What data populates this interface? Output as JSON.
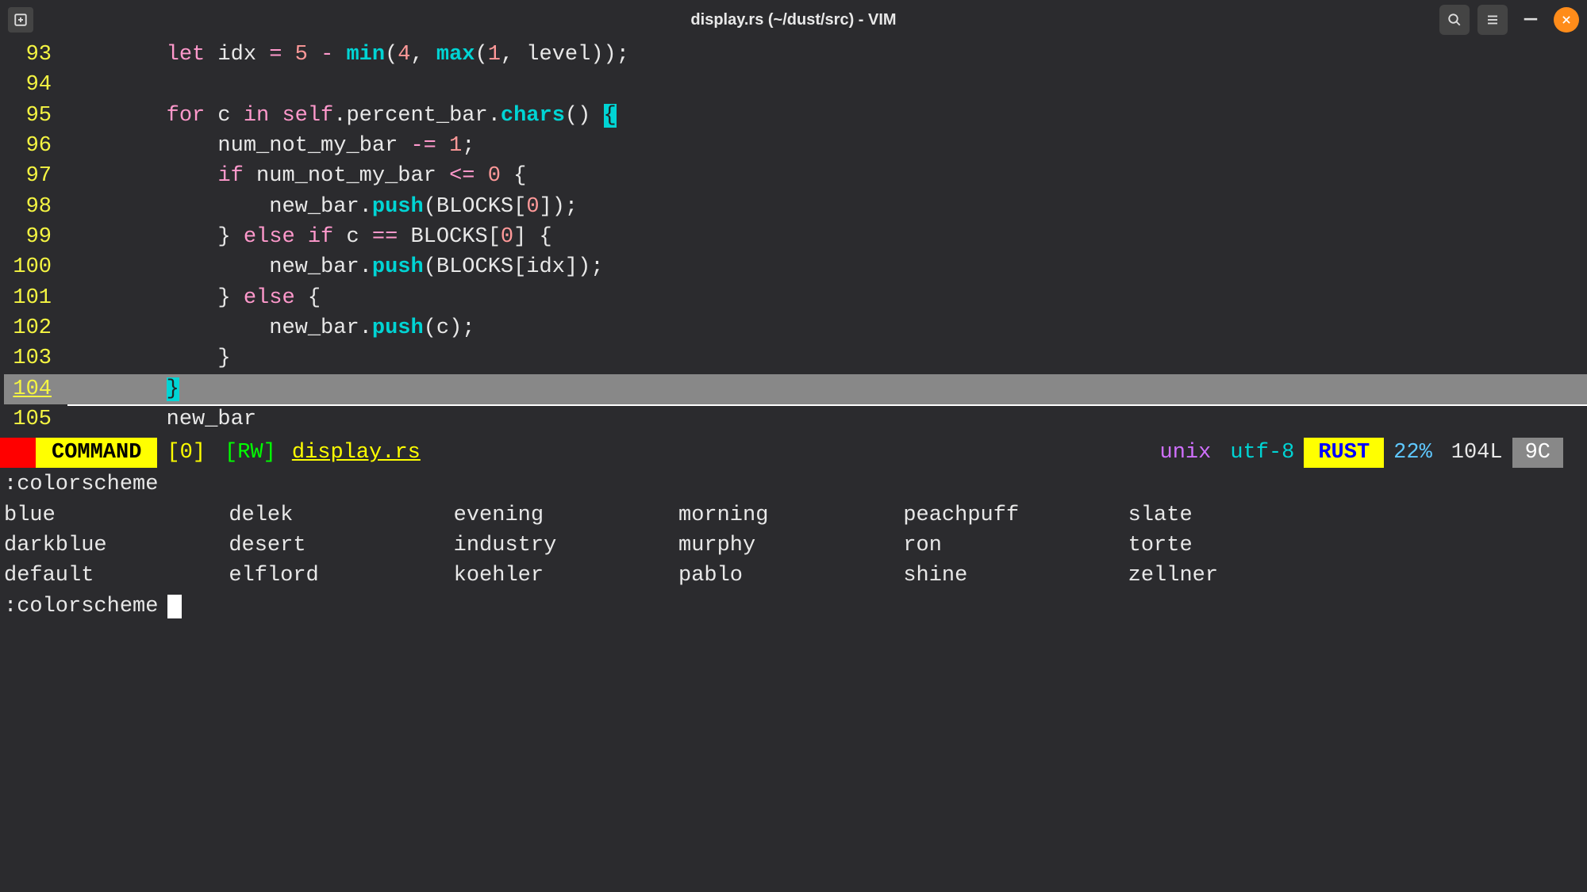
{
  "title": "display.rs (~/dust/src) - VIM",
  "code": {
    "lines": [
      {
        "num": "93",
        "tokens": [
          {
            "t": "plain",
            "v": "        "
          },
          {
            "t": "keyword",
            "v": "let"
          },
          {
            "t": "plain",
            "v": " idx "
          },
          {
            "t": "op",
            "v": "="
          },
          {
            "t": "plain",
            "v": " "
          },
          {
            "t": "number",
            "v": "5"
          },
          {
            "t": "plain",
            "v": " "
          },
          {
            "t": "op",
            "v": "-"
          },
          {
            "t": "plain",
            "v": " "
          },
          {
            "t": "func",
            "v": "min"
          },
          {
            "t": "plain",
            "v": "("
          },
          {
            "t": "number",
            "v": "4"
          },
          {
            "t": "plain",
            "v": ", "
          },
          {
            "t": "func",
            "v": "max"
          },
          {
            "t": "plain",
            "v": "("
          },
          {
            "t": "number",
            "v": "1"
          },
          {
            "t": "plain",
            "v": ", level));"
          }
        ]
      },
      {
        "num": "94",
        "tokens": []
      },
      {
        "num": "95",
        "tokens": [
          {
            "t": "plain",
            "v": "        "
          },
          {
            "t": "keyword",
            "v": "for"
          },
          {
            "t": "plain",
            "v": " c "
          },
          {
            "t": "keyword",
            "v": "in"
          },
          {
            "t": "plain",
            "v": " "
          },
          {
            "t": "keyword",
            "v": "self"
          },
          {
            "t": "plain",
            "v": ".percent_bar."
          },
          {
            "t": "func",
            "v": "chars"
          },
          {
            "t": "plain",
            "v": "() "
          },
          {
            "t": "match",
            "v": "{"
          }
        ]
      },
      {
        "num": "96",
        "tokens": [
          {
            "t": "plain",
            "v": "            num_not_my_bar "
          },
          {
            "t": "op",
            "v": "-="
          },
          {
            "t": "plain",
            "v": " "
          },
          {
            "t": "number",
            "v": "1"
          },
          {
            "t": "plain",
            "v": ";"
          }
        ]
      },
      {
        "num": "97",
        "tokens": [
          {
            "t": "plain",
            "v": "            "
          },
          {
            "t": "keyword",
            "v": "if"
          },
          {
            "t": "plain",
            "v": " num_not_my_bar "
          },
          {
            "t": "op",
            "v": "<="
          },
          {
            "t": "plain",
            "v": " "
          },
          {
            "t": "number",
            "v": "0"
          },
          {
            "t": "plain",
            "v": " {"
          }
        ]
      },
      {
        "num": "98",
        "tokens": [
          {
            "t": "plain",
            "v": "                new_bar."
          },
          {
            "t": "func",
            "v": "push"
          },
          {
            "t": "plain",
            "v": "(BLOCKS["
          },
          {
            "t": "number",
            "v": "0"
          },
          {
            "t": "plain",
            "v": "]);"
          }
        ]
      },
      {
        "num": "99",
        "tokens": [
          {
            "t": "plain",
            "v": "            } "
          },
          {
            "t": "keyword",
            "v": "else"
          },
          {
            "t": "plain",
            "v": " "
          },
          {
            "t": "keyword",
            "v": "if"
          },
          {
            "t": "plain",
            "v": " c "
          },
          {
            "t": "op",
            "v": "=="
          },
          {
            "t": "plain",
            "v": " BLOCKS["
          },
          {
            "t": "number",
            "v": "0"
          },
          {
            "t": "plain",
            "v": "] {"
          }
        ]
      },
      {
        "num": "100",
        "tokens": [
          {
            "t": "plain",
            "v": "                new_bar."
          },
          {
            "t": "func",
            "v": "push"
          },
          {
            "t": "plain",
            "v": "(BLOCKS[idx]);"
          }
        ]
      },
      {
        "num": "101",
        "tokens": [
          {
            "t": "plain",
            "v": "            } "
          },
          {
            "t": "keyword",
            "v": "else"
          },
          {
            "t": "plain",
            "v": " {"
          }
        ]
      },
      {
        "num": "102",
        "tokens": [
          {
            "t": "plain",
            "v": "                new_bar."
          },
          {
            "t": "func",
            "v": "push"
          },
          {
            "t": "plain",
            "v": "(c);"
          }
        ]
      },
      {
        "num": "103",
        "tokens": [
          {
            "t": "plain",
            "v": "            }"
          }
        ]
      },
      {
        "num": "104",
        "cursor": true,
        "tokens": [
          {
            "t": "plain",
            "v": "        "
          },
          {
            "t": "match",
            "v": "}"
          }
        ]
      },
      {
        "num": "105",
        "tokens": [
          {
            "t": "plain",
            "v": "        new_bar"
          }
        ]
      }
    ]
  },
  "status": {
    "mode": "COMMAND",
    "bufnum": "[0]",
    "rw": "[RW]",
    "file": "display.rs",
    "ff": "unix",
    "enc": "utf-8",
    "lang": "RUST",
    "percent": "22%",
    "lines": "104L",
    "col": "9C"
  },
  "cmdline": {
    "label": ":colorscheme",
    "completions": [
      "blue",
      "darkblue",
      "default",
      "delek",
      "desert",
      "elflord",
      "evening",
      "industry",
      "koehler",
      "morning",
      "murphy",
      "pablo",
      "peachpuff",
      "ron",
      "shine",
      "slate",
      "torte",
      "zellner"
    ],
    "input": ":colorscheme "
  }
}
